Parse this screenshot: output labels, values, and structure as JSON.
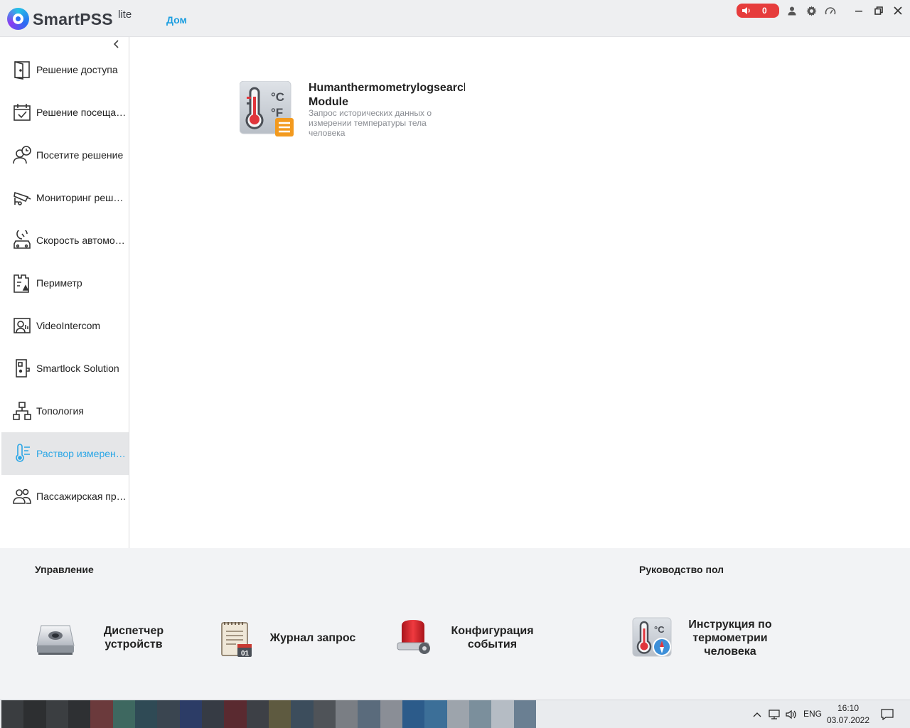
{
  "titlebar": {
    "app_name": "SmartPSS",
    "app_suffix": "lite",
    "home_tab": "Дом",
    "alarm_count": "0",
    "accent_color": "#1a9de0",
    "alarm_color": "#e63c3c"
  },
  "sidebar": {
    "items": [
      {
        "label": "Решение доступа",
        "icon": "door-icon"
      },
      {
        "label": "Решение посещаемости",
        "icon": "calendar-check-icon"
      },
      {
        "label": "Посетите решение",
        "icon": "visitor-clock-icon"
      },
      {
        "label": "Мониторинг решение",
        "icon": "cctv-camera-icon"
      },
      {
        "label": "Скорость автомобиля",
        "icon": "car-speed-icon"
      },
      {
        "label": "Периметр",
        "icon": "perimeter-icon"
      },
      {
        "label": "VideoIntercom",
        "icon": "intercom-icon"
      },
      {
        "label": "Smartlock Solution",
        "icon": "smartlock-icon"
      },
      {
        "label": "Топология",
        "icon": "topology-icon"
      },
      {
        "label": "Раствор измерения температуры",
        "icon": "thermometer-icon"
      },
      {
        "label": "Пассажирская проходка",
        "icon": "passengers-icon"
      }
    ],
    "active_index": 9
  },
  "main": {
    "module": {
      "title_line1": "Humanthermometrylogsearch",
      "title_line2": "Module",
      "description": "Запрос исторических данных о измерении температуры тела человека"
    }
  },
  "bottom": {
    "management_title": "Управление",
    "guide_title": "Руководство пользователя",
    "tools": [
      {
        "label": "Диспетчер устройств",
        "icon": "device-manager-icon"
      },
      {
        "label": "Журнал запрос",
        "icon": "log-query-icon"
      },
      {
        "label": "Конфигурация события",
        "icon": "event-config-icon"
      }
    ],
    "guide": {
      "label": "Инструкция по термометрии человека",
      "icon": "thermometry-guide-icon"
    }
  },
  "taskbar": {
    "lang": "ENG",
    "time": "16:10",
    "date": "03.07.2022"
  }
}
